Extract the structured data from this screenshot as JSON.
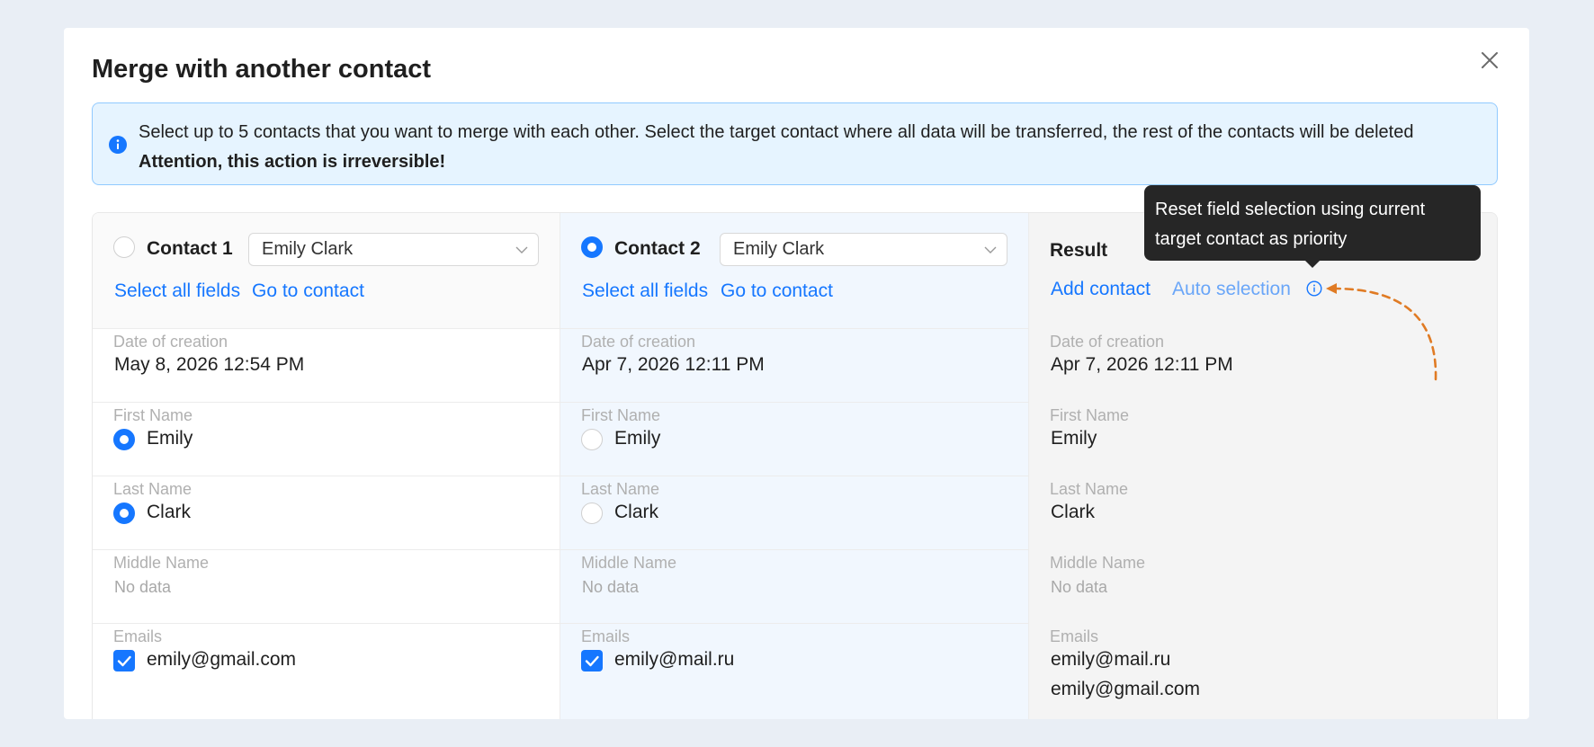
{
  "dialog": {
    "title": "Merge with another contact"
  },
  "banner": {
    "line1": "Select up to 5 contacts that you want to merge with each other. Select the target contact where all data will be transferred, the rest of the contacts will be deleted",
    "line2": "Attention, this action is irreversible!"
  },
  "columns": [
    {
      "label": "Contact 1",
      "selected": false,
      "select_value": "Emily Clark",
      "select_all_label": "Select all fields",
      "goto_label": "Go to contact",
      "fields": {
        "date_label": "Date of creation",
        "date_value": "May 8, 2026 12:54 PM",
        "first_name_label": "First Name",
        "first_name_value": "Emily",
        "first_name_selected": true,
        "last_name_label": "Last Name",
        "last_name_value": "Clark",
        "last_name_selected": true,
        "middle_name_label": "Middle Name",
        "middle_name_value": "No data",
        "emails_label": "Emails",
        "email_value": "emily@gmail.com",
        "email_checked": true
      }
    },
    {
      "label": "Contact 2",
      "selected": true,
      "select_value": "Emily Clark",
      "select_all_label": "Select all fields",
      "goto_label": "Go to contact",
      "fields": {
        "date_label": "Date of creation",
        "date_value": "Apr 7, 2026 12:11 PM",
        "first_name_label": "First Name",
        "first_name_value": "Emily",
        "first_name_selected": false,
        "last_name_label": "Last Name",
        "last_name_value": "Clark",
        "last_name_selected": false,
        "middle_name_label": "Middle Name",
        "middle_name_value": "No data",
        "emails_label": "Emails",
        "email_value": "emily@mail.ru",
        "email_checked": true
      }
    }
  ],
  "result": {
    "title": "Result",
    "add_contact_label": "Add contact",
    "auto_selection_label": "Auto selection",
    "fields": {
      "date_label": "Date of creation",
      "date_value": "Apr 7, 2026 12:11 PM",
      "first_name_label": "First Name",
      "first_name_value": "Emily",
      "last_name_label": "Last Name",
      "last_name_value": "Clark",
      "middle_name_label": "Middle Name",
      "middle_name_value": "No data",
      "emails_label": "Emails",
      "emails": [
        "emily@mail.ru",
        "emily@gmail.com"
      ]
    }
  },
  "tooltip": {
    "text": "Reset field selection using current target contact as priority"
  },
  "icons": {
    "close": "close-icon",
    "info": "info-icon",
    "chevron": "chevron-down-icon",
    "check": "check-icon",
    "hint": "info-outline-icon"
  },
  "colors": {
    "accent": "#1677ff",
    "banner_bg": "#e6f4ff",
    "banner_border": "#91caff",
    "target_column_bg": "#f1f7fe",
    "result_column_bg": "#f4f4f4",
    "tooltip_bg": "#262626",
    "annotation": "#e07b24"
  }
}
